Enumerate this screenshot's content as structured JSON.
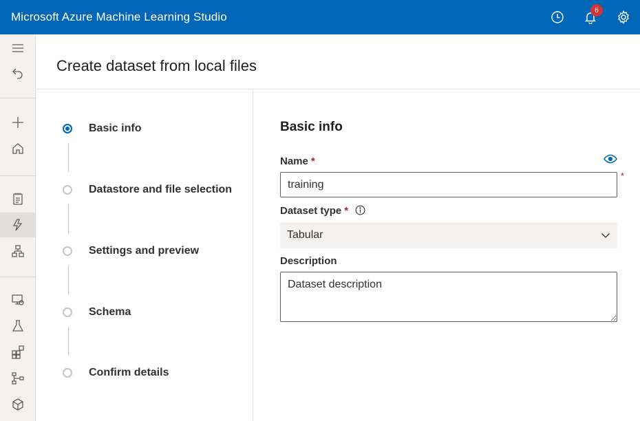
{
  "app": {
    "title": "Microsoft Azure Machine Learning Studio"
  },
  "topbar": {
    "icons": [
      "clock-icon",
      "bell-icon",
      "gear-icon"
    ],
    "notification_count": "6"
  },
  "rail": {
    "items": [
      "menu-icon",
      "back-icon",
      "plus-icon",
      "home-icon",
      "notebook-icon",
      "lightning-icon",
      "hierarchy-icon",
      "monitor-icon",
      "flask-icon",
      "grid-icon",
      "pipeline-icon",
      "cube-icon"
    ]
  },
  "page": {
    "title": "Create dataset from local files"
  },
  "steps": [
    {
      "label": "Basic info",
      "active": true
    },
    {
      "label": "Datastore and file selection",
      "active": false
    },
    {
      "label": "Settings and preview",
      "active": false
    },
    {
      "label": "Schema",
      "active": false
    },
    {
      "label": "Confirm details",
      "active": false
    }
  ],
  "form": {
    "section_title": "Basic info",
    "name": {
      "label": "Name",
      "required_mark": "*",
      "value": "training"
    },
    "outside_required_mark": "*",
    "dataset_type": {
      "label": "Dataset type",
      "required_mark": "*",
      "selected": "Tabular"
    },
    "description": {
      "label": "Description",
      "placeholder": "Dataset description"
    }
  },
  "colors": {
    "brand": "#0067b8",
    "required": "#a4262c",
    "badge": "#d13438"
  }
}
